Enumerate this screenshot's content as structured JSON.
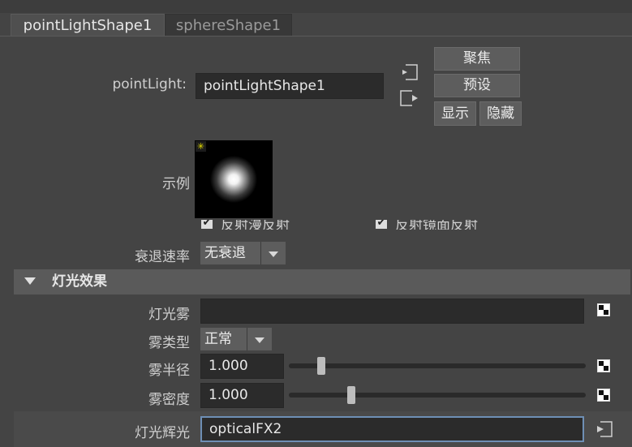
{
  "tabs": [
    {
      "label": "pointLightShape1",
      "active": true
    },
    {
      "label": "sphereShape1",
      "active": false
    }
  ],
  "header": {
    "node_label": "pointLight:",
    "node_value": "pointLightShape1",
    "focus_button": "聚焦",
    "preset_button": "预设",
    "show_button": "显示",
    "hide_button": "隐藏"
  },
  "sample": {
    "label": "示例"
  },
  "reflect": {
    "diffuse_label": "反射漫反射",
    "specular_label": "反射镜面反射",
    "diffuse_checked": true,
    "specular_checked": true
  },
  "decay": {
    "label": "衰退速率",
    "value": "无衰退"
  },
  "light_effects": {
    "section_title": "灯光效果",
    "fog_label": "灯光雾",
    "fog_value": "",
    "fog_type_label": "雾类型",
    "fog_type_value": "正常",
    "fog_radius_label": "雾半径",
    "fog_radius_value": "1.000",
    "fog_radius_fraction": 0.11,
    "fog_density_label": "雾密度",
    "fog_density_value": "1.000",
    "fog_density_fraction": 0.21,
    "glow_label": "灯光辉光",
    "glow_value": "opticalFX2"
  },
  "colors": {
    "background": "#444444",
    "field": "#2b2b2b",
    "section": "#5a5a5a",
    "glow_border": "#6e8fb5"
  }
}
